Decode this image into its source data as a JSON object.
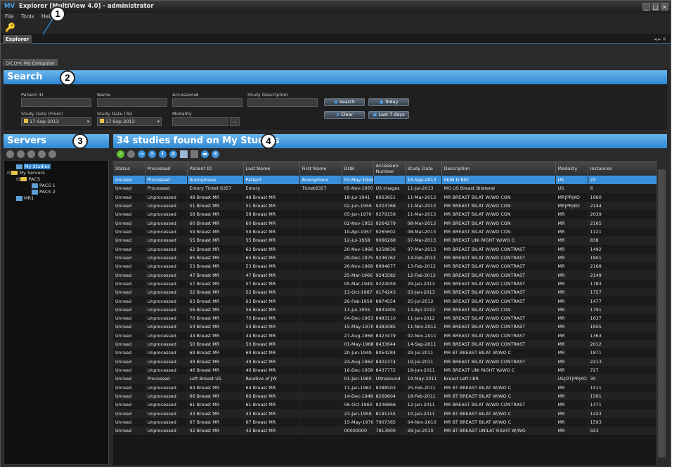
{
  "window": {
    "title": "Explorer [MultiView 4.0] - administrator",
    "logo": "MV",
    "controls": [
      "_",
      "□",
      "✕"
    ]
  },
  "menu": [
    "File",
    "Tools",
    "Help"
  ],
  "tabs": {
    "explorer": "Explorer",
    "sub": [
      "DICOM",
      "My Computer"
    ]
  },
  "search": {
    "title": "Search",
    "labels": {
      "patient_id": "Patient ID",
      "name": "Name",
      "accession": "Accession#",
      "study_desc": "Study Description",
      "date_from": "Study Date (From)",
      "date_to": "Study Date (To)",
      "modality": "Modality"
    },
    "date_from": "17-Sep-2013",
    "date_to": "17-Sep-2013",
    "buttons": {
      "search": "Search",
      "today": "Today",
      "clear": "Clear",
      "last7": "Last 7 days"
    }
  },
  "servers": {
    "title": "Servers",
    "tree": [
      {
        "label": "My Studies",
        "level": 1,
        "selected": true
      },
      {
        "label": "My Servers",
        "level": 0
      },
      {
        "label": "PACS",
        "level": 1
      },
      {
        "label": "PACS 1",
        "level": 2
      },
      {
        "label": "PACS 2",
        "level": 2
      },
      {
        "label": "MR1",
        "level": 1
      }
    ]
  },
  "results": {
    "title": "34 studies found on My Studies",
    "columns": [
      "Status",
      "Processed",
      "Patient ID",
      "Last Name",
      "First Name",
      "DOB",
      "Accession Number",
      "Study Date",
      "Description",
      "Modality",
      "Instances"
    ],
    "rows": [
      [
        "Unread",
        "Processed",
        "Anonymous",
        "Patient",
        "Anonymous",
        "03-May-1944",
        "",
        "16-Sep-2013",
        "SKIN D BIO",
        "US",
        "70"
      ],
      [
        "Unread",
        "Processed",
        "Emory Ticket 6357",
        "Emory",
        "Ticket6357",
        "05-Nov-1970",
        "US images",
        "11-Jul-2013",
        "MG US Breast Bilateral",
        "US",
        "6"
      ],
      [
        "Unread",
        "Unprocessed",
        "48 Breast MR",
        "48 Breast MR",
        "",
        "18-Jul-1941",
        "8663651",
        "11-Mar-2013",
        "MR BREAST BILAT W/WO CON",
        "MR|PR|KO",
        "1960"
      ],
      [
        "Unread",
        "Unprocessed",
        "51 Breast MR",
        "51 Breast MR",
        "",
        "02-Jun-1956",
        "9203768",
        "11-Mar-2013",
        "MR BREAST BILAT W/WO CON",
        "MR|PR|KO",
        "2144"
      ],
      [
        "Unread",
        "Unprocessed",
        "58 Breast MR",
        "58 Breast MR",
        "",
        "05-Jan-1970",
        "9279159",
        "11-Mar-2013",
        "MR BREAST BILAT W/WO CON",
        "MR",
        "2039"
      ],
      [
        "Unread",
        "Unprocessed",
        "60 Breast MR",
        "60 Breast MR",
        "",
        "02-Nov-1952",
        "9264279",
        "08-Mar-2013",
        "MR BREAST BILAT W/WO CON",
        "MR",
        "2165"
      ],
      [
        "Unread",
        "Unprocessed",
        "59 Breast MR",
        "59 Breast MR",
        "",
        "10-Apr-1957",
        "9265602",
        "08-Mar-2013",
        "MR BREAST BILAT W/WO CON",
        "MR",
        "1121"
      ],
      [
        "Unread",
        "Unprocessed",
        "55 Breast MR",
        "55 Breast MR",
        "",
        "12-Jul-1958",
        "9066268",
        "07-Mar-2013",
        "MR BREAST UNI RIGHT W/WO C",
        "MR",
        "838"
      ],
      [
        "Unread",
        "Unprocessed",
        "62 Breast MR",
        "62 Breast MR",
        "",
        "20-Nov-1966",
        "9258836",
        "07-Mar-2013",
        "MR BREAST BILAT W/WO CONTRAST",
        "MR",
        "1492"
      ],
      [
        "Unread",
        "Unprocessed",
        "65 Breast MR",
        "65 Breast MR",
        "",
        "29-Dec-1975",
        "9236762",
        "14-Feb-2013",
        "MR BREAST BILAT W/WO CONTRAST",
        "MR",
        "1901"
      ],
      [
        "Unread",
        "Unprocessed",
        "53 Breast MR",
        "53 Breast MR",
        "",
        "26-Nov-1968",
        "8994677",
        "13-Feb-2013",
        "MR BREAST BILAT W/WO CONTRAST",
        "MR",
        "2168"
      ],
      [
        "Unread",
        "Unprocessed",
        "47 Breast MR",
        "47 Breast MR",
        "",
        "25-Mar-1966",
        "9243582",
        "12-Feb-2013",
        "MR BREAST BILAT W/WO CONTRAST",
        "MR",
        "2149"
      ],
      [
        "Unread",
        "Unprocessed",
        "57 Breast MR",
        "57 Breast MR",
        "",
        "05-Mar-1949",
        "9224059",
        "29-Jan-2013",
        "MR BREAST BILAT W/WO CONTRAST",
        "MR",
        "1783"
      ],
      [
        "Unread",
        "Unprocessed",
        "52 Breast MR",
        "52 Breast MR",
        "",
        "13-Oct-1967",
        "9174243",
        "03-Jan-2013",
        "MR BREAST BILAT W/WO CONTRAST",
        "MR",
        "1757"
      ],
      [
        "Unread",
        "Unprocessed",
        "63 Breast MR",
        "63 Breast MR",
        "",
        "26-Feb-1959",
        "8974554",
        "25-Jul-2012",
        "MR BREAST BILAT W/WO CONTRAST",
        "MR",
        "1477"
      ],
      [
        "Unread",
        "Unprocessed",
        "56 Breast MR",
        "56 Breast MR",
        "",
        "13-Jul-1955",
        "8833405",
        "13-Apr-2012",
        "MR BREAST BILAT W/WO CON",
        "MR",
        "1791"
      ],
      [
        "Unread",
        "Unprocessed",
        "70 Breast MR",
        "70 Breast MR",
        "",
        "04-Dec-1963",
        "8483110",
        "11-Jan-2012",
        "MR BREAST BILAT W/WO CONTRAST",
        "MR",
        "1637"
      ],
      [
        "Unread",
        "Unprocessed",
        "54 Breast MR",
        "54 Breast MR",
        "",
        "15-May-1970",
        "8383085",
        "11-Nov-2011",
        "MR BREAST BILAT W/WO CONTRAST",
        "MR",
        "1955"
      ],
      [
        "Unread",
        "Unprocessed",
        "44 Breast MR",
        "44 Breast MR",
        "",
        "27-Aug-1968",
        "8423479",
        "02-Nov-2011",
        "MR BREAST BILAT W/WO CONTRAST",
        "MR",
        "1363"
      ],
      [
        "Unread",
        "Unprocessed",
        "50 Breast MR",
        "50 Breast MR",
        "",
        "01-May-1968",
        "8433644",
        "14-Sep-2011",
        "MR BREAST BILAT W/WO CONTRAST",
        "MR",
        "2012"
      ],
      [
        "Unread",
        "Unprocessed",
        "69 Breast MR",
        "69 Breast MR",
        "",
        "20-Jun-1949",
        "8054284",
        "29-Jul-2011",
        "MR BT BREAST BILAT W/WO C",
        "MR",
        "1871"
      ],
      [
        "Unread",
        "Unprocessed",
        "49 Breast MR",
        "49 Breast MR",
        "",
        "24-Aug-1962",
        "8401374",
        "19-Jul-2011",
        "MR BREAST BILAT W/WO CONTRAST",
        "MR",
        "2213"
      ],
      [
        "Unread",
        "Unprocessed",
        "46 Breast MR",
        "46 Breast MR",
        "",
        "16-Dec-1958",
        "8437772",
        "18-Jun-2011",
        "MR BREAST UNI RIGHT W/WO C",
        "MR",
        "727"
      ],
      [
        "Unread",
        "Processed",
        "Left Breast US",
        "Relative of JW",
        "",
        "01-Jan-1960",
        "Ultrasound",
        "19-May-2011",
        "Breast Left I-BR",
        "US|OT|PR|KO",
        "30"
      ],
      [
        "Unread",
        "Unprocessed",
        "64 Breast MR",
        "64 Breast MR",
        "",
        "11-Jan-1962",
        "8288503",
        "25-Feb-2011",
        "MR BT BREAST BILAT W/WO C",
        "MR",
        "1511"
      ],
      [
        "Unread",
        "Unprocessed",
        "66 Breast MR",
        "66 Breast MR",
        "",
        "14-Dec-1948",
        "8269804",
        "18-Feb-2011",
        "MR BT BREAST BILAT W/WO C",
        "MR",
        "1561"
      ],
      [
        "Unread",
        "Unprocessed",
        "61 Breast MR",
        "61 Breast MR",
        "",
        "06-Oct-1960",
        "8206866",
        "12-Jan-2011",
        "MR BREAST BILAT W/WO CONTRAST",
        "MR",
        "1471"
      ],
      [
        "Unread",
        "Unprocessed",
        "43 Breast MR",
        "43 Breast MR",
        "",
        "23-Jan-1959",
        "8191155",
        "10-Jan-2011",
        "MR BT BREAST BILAT W/WO C",
        "MR",
        "1423"
      ],
      [
        "Unread",
        "Unprocessed",
        "67 Breast MR",
        "67 Breast MR",
        "",
        "15-May-1970",
        "7907365",
        "04-Nov-2010",
        "MR BT BREAST BILAT W/WO C",
        "MR",
        "1593"
      ],
      [
        "Unread",
        "Unprocessed",
        "42 Breast MR",
        "42 Breast MR",
        "",
        "00000000",
        "7813900",
        "28-Jul-2010",
        "MR BT BREAST UNILAT RIGHT W/WO",
        "MR",
        "923"
      ]
    ]
  },
  "callouts": [
    "1",
    "2",
    "3",
    "4"
  ],
  "colors": {
    "header_blue": "#2f86d3",
    "selected_row": "#3a8fd9",
    "background": "#2a2a2a"
  }
}
